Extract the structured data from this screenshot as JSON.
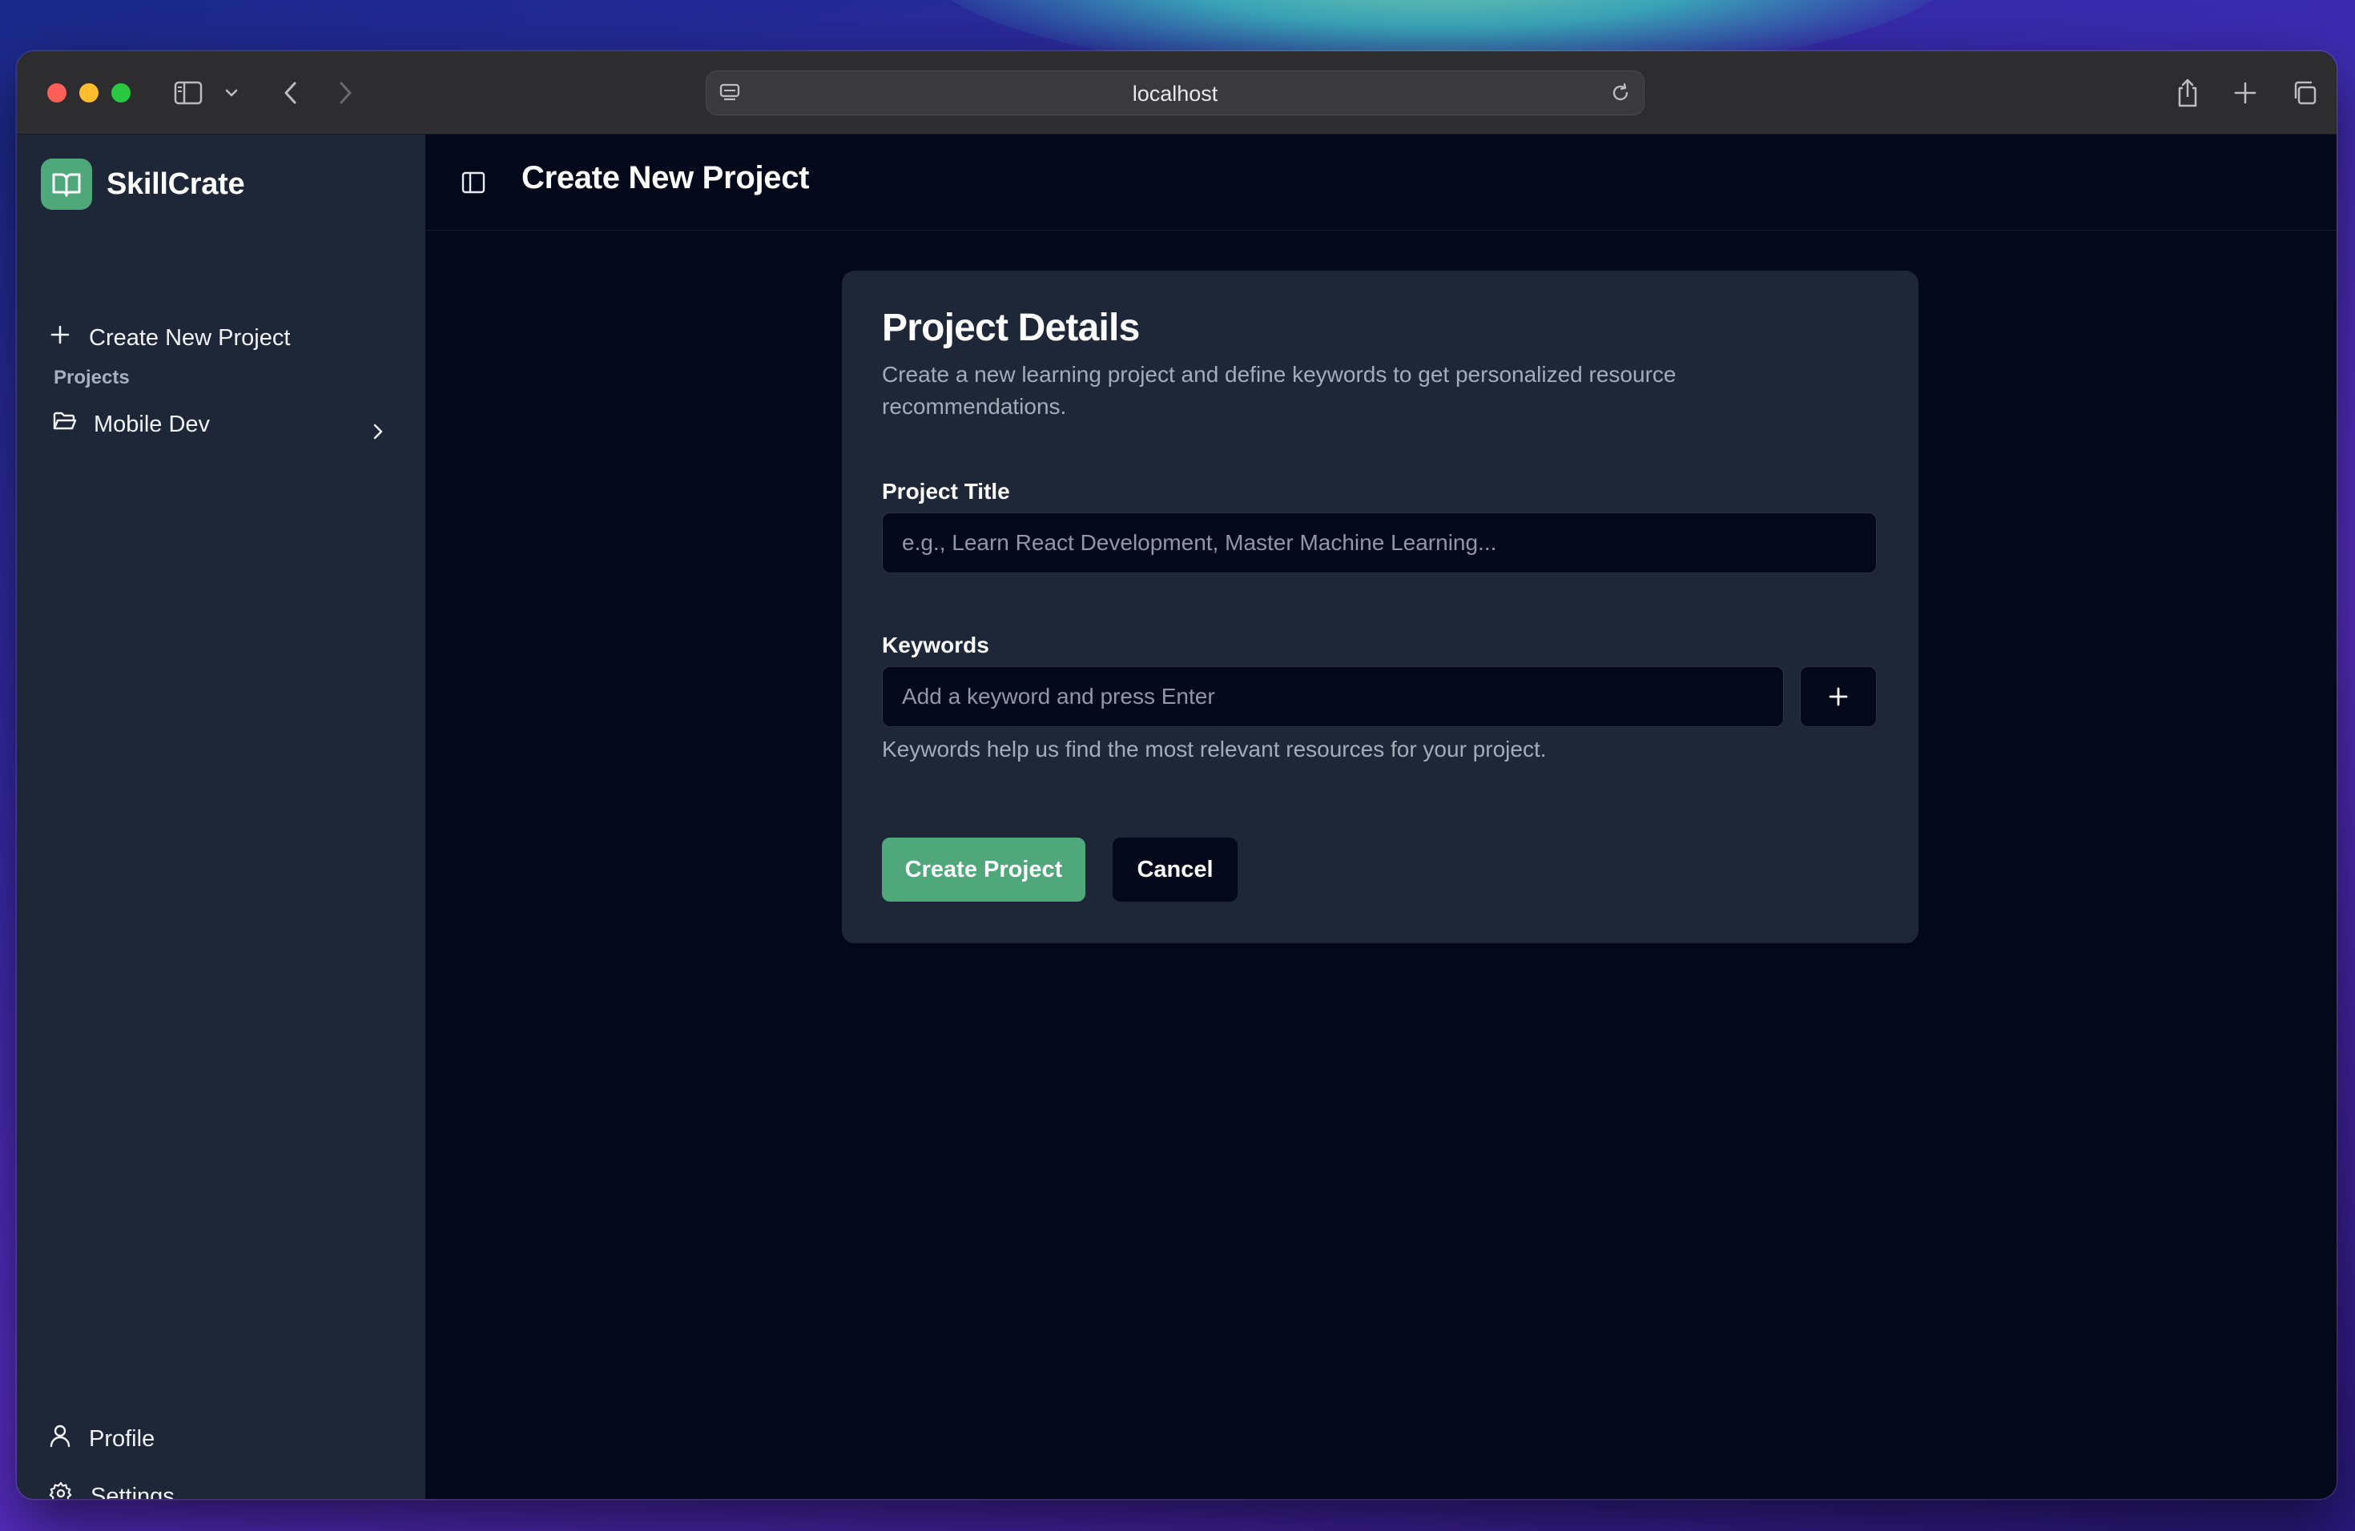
{
  "browser": {
    "url": "localhost",
    "icons": [
      "sidebar-icon",
      "chevron-down-icon",
      "back-icon",
      "forward-icon",
      "site-settings-icon",
      "reload-icon",
      "share-icon",
      "new-tab-icon",
      "tabs-overview-icon"
    ]
  },
  "sidebar": {
    "brand": "SkillCrate",
    "create_label": "Create New Project",
    "section_label": "Projects",
    "projects": [
      {
        "label": "Mobile Dev"
      }
    ],
    "footer": [
      {
        "label": "Profile"
      },
      {
        "label": "Settings"
      }
    ]
  },
  "header": {
    "title": "Create New Project"
  },
  "card": {
    "title": "Project Details",
    "description": "Create a new learning project and define keywords to get personalized resource recommendations.",
    "title_label": "Project Title",
    "title_placeholder": "e.g., Learn React Development, Master Machine Learning...",
    "keywords_label": "Keywords",
    "keywords_placeholder": "Add a keyword and press Enter",
    "keywords_hint": "Keywords help us find the most relevant resources for your project.",
    "submit_label": "Create Project",
    "cancel_label": "Cancel"
  },
  "colors": {
    "accent": "#4fa87a",
    "sidebar_bg": "#1d2738",
    "main_bg": "#03091a",
    "card_bg": "#1e2738"
  }
}
